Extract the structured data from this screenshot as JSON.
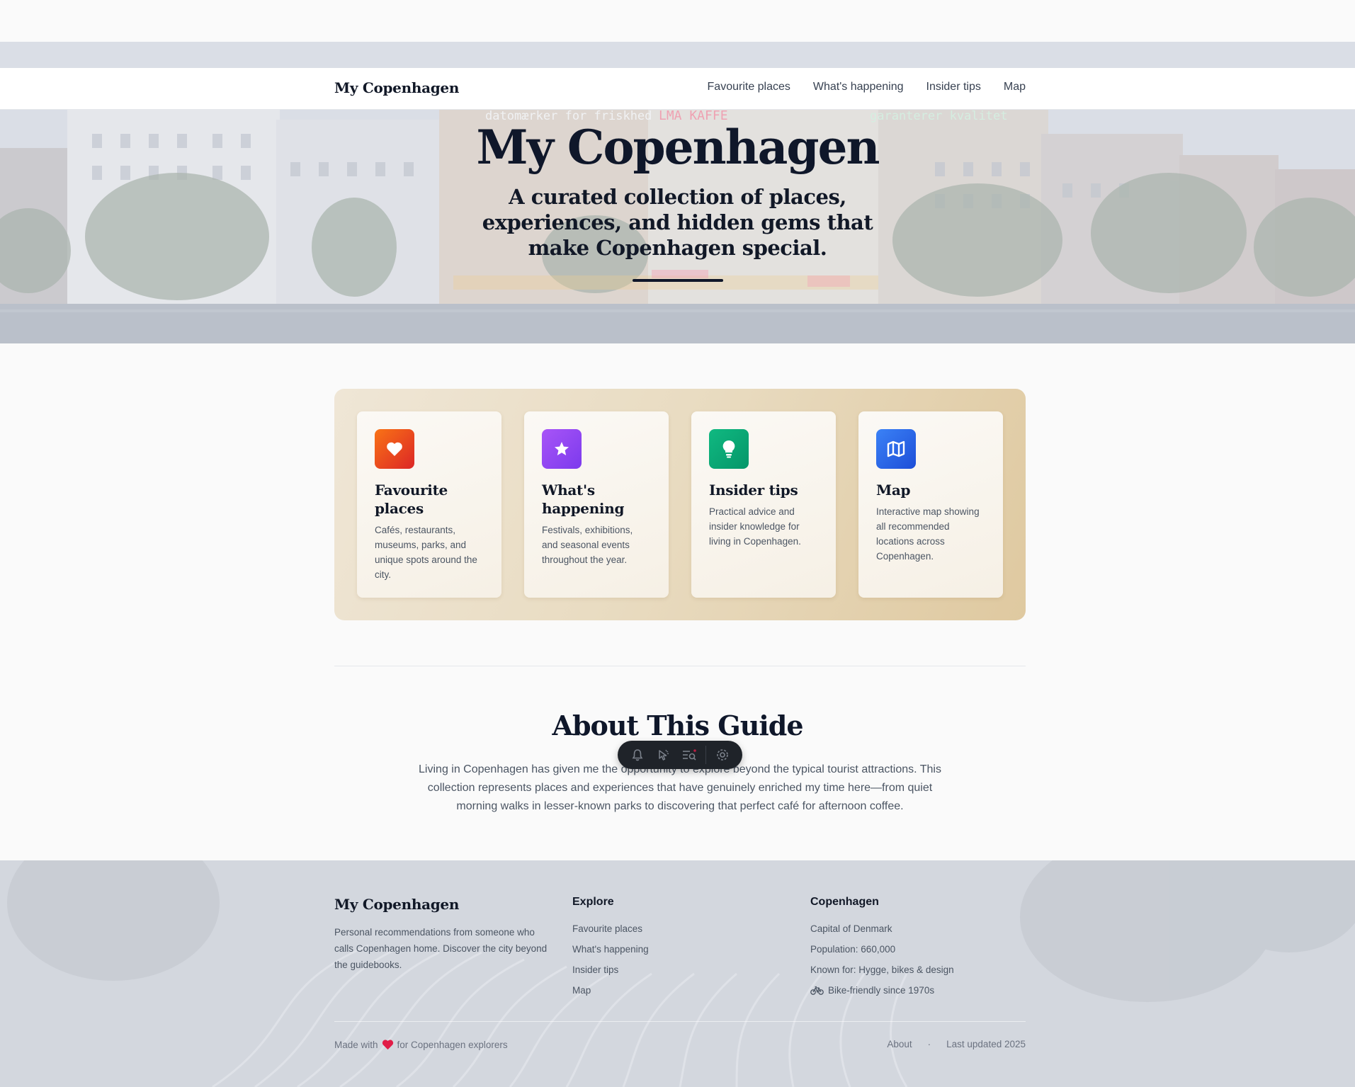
{
  "nav": {
    "brand": "My Copenhagen",
    "links": [
      "Favourite places",
      "What's happening",
      "Insider tips",
      "Map"
    ]
  },
  "hero": {
    "title": "My Copenhagen",
    "subtitle": "A curated collection of places, experiences, and hidden gems that make Copenhagen special.",
    "sign_text_left": "datomærker for friskhed",
    "sign_text_mid": "LMA KAFFE",
    "sign_text_right": "garanterer kvalitet"
  },
  "cards": [
    {
      "title": "Favourite places",
      "desc": "Cafés, restaurants, museums, parks, and unique spots around the city.",
      "icon": "heart-icon",
      "color_from": "#f97316",
      "color_to": "#dc2626"
    },
    {
      "title": "What's happening",
      "desc": "Festivals, exhibitions, and seasonal events throughout the year.",
      "icon": "star-icon",
      "color_from": "#a855f7",
      "color_to": "#7c3aed"
    },
    {
      "title": "Insider tips",
      "desc": "Practical advice and insider knowledge for living in Copenhagen.",
      "icon": "lightbulb-icon",
      "color_from": "#10b981",
      "color_to": "#059669"
    },
    {
      "title": "Map",
      "desc": "Interactive map showing all recommended locations across Copenhagen.",
      "icon": "map-icon",
      "color_from": "#3b82f6",
      "color_to": "#1d4ed8"
    }
  ],
  "about": {
    "title": "About This Guide",
    "text": "Living in Copenhagen has given me the opportunity to explore beyond the typical tourist attractions. This collection represents places and experiences that have genuinely enriched my time here—from quiet morning walks in lesser-known parks to discovering that perfect café for afternoon coffee."
  },
  "toolbar": {
    "icons": [
      "bell-icon",
      "cursor-icon",
      "search-list-icon",
      "gear-icon"
    ]
  },
  "footer": {
    "brand": "My Copenhagen",
    "desc": "Personal recommendations from someone who calls Copenhagen home. Discover the city beyond the guidebooks.",
    "explore_title": "Explore",
    "explore_links": [
      "Favourite places",
      "What's happening",
      "Insider tips",
      "Map"
    ],
    "city_title": "Copenhagen",
    "city_facts": [
      "Capital of Denmark",
      "Population: 660,000",
      "Known for: Hygge, bikes & design",
      "Bike-friendly since 1970s"
    ],
    "made_with_prefix": "Made with",
    "made_with_suffix": "for Copenhagen explorers",
    "about_link": "About",
    "dot": "·",
    "last_updated": "Last updated 2025"
  },
  "colors": {
    "accent_dark": "#0f172a",
    "panel_gold": "#dfc9a0",
    "heart_red": "#e11d48"
  }
}
